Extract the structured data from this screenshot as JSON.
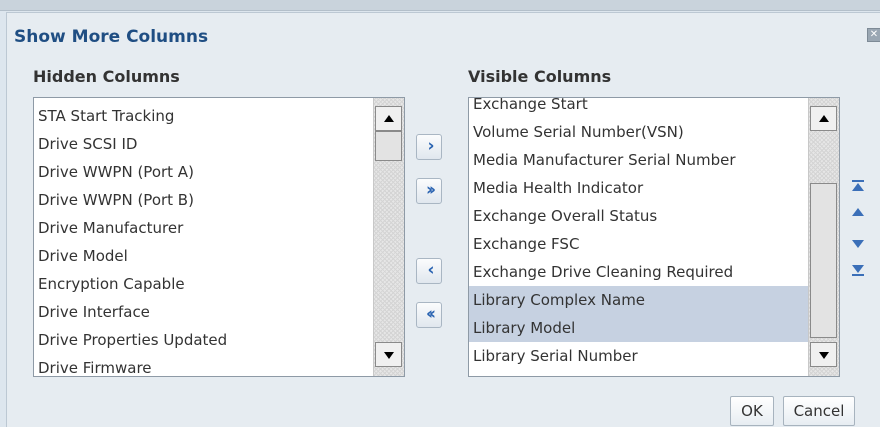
{
  "dialog": {
    "title": "Show More Columns",
    "close_icon": "close-icon"
  },
  "hidden_columns": {
    "header": "Hidden Columns",
    "items": [
      "STA Start Tracking",
      "Drive SCSI ID",
      "Drive WWPN (Port A)",
      "Drive WWPN (Port B)",
      "Drive Manufacturer",
      "Drive Model",
      "Encryption Capable",
      "Drive Interface",
      "Drive Properties Updated",
      "Drive Firmware"
    ]
  },
  "visible_columns": {
    "header": "Visible Columns",
    "items": [
      {
        "label": "Exchange Start",
        "selected": false
      },
      {
        "label": "Volume Serial Number(VSN)",
        "selected": false
      },
      {
        "label": "Media Manufacturer Serial Number",
        "selected": false
      },
      {
        "label": "Media Health Indicator",
        "selected": false
      },
      {
        "label": "Exchange Overall Status",
        "selected": false
      },
      {
        "label": "Exchange FSC",
        "selected": false
      },
      {
        "label": "Exchange Drive Cleaning Required",
        "selected": false
      },
      {
        "label": "Library Complex Name",
        "selected": true
      },
      {
        "label": "Library Model",
        "selected": true
      },
      {
        "label": "Library Serial Number",
        "selected": false
      }
    ]
  },
  "move_buttons": {
    "move_selected": "move-right-icon",
    "move_all": "move-all-right-icon",
    "remove_selected": "move-left-icon",
    "remove_all": "move-all-left-icon"
  },
  "reorder_buttons": {
    "top": "move-to-top-icon",
    "up": "move-up-icon",
    "down": "move-down-icon",
    "bottom": "move-to-bottom-icon"
  },
  "buttons": {
    "ok": "OK",
    "cancel": "Cancel"
  },
  "colors": {
    "title": "#1f4e83",
    "selection": "#c6d1e1",
    "arrow": "#2a63b1"
  }
}
